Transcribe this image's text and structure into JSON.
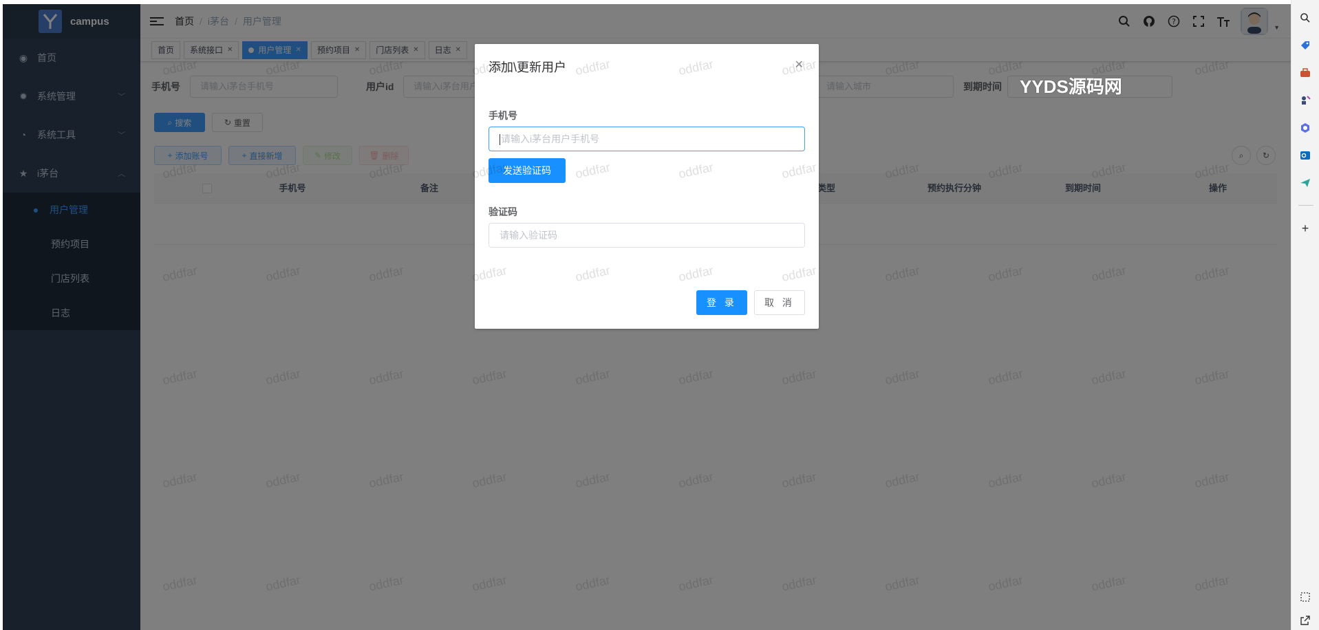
{
  "sidebar": {
    "brand": "campus",
    "items": [
      {
        "label": "首页",
        "icon": "dashboard-icon"
      },
      {
        "label": "系统管理",
        "icon": "gear-icon"
      },
      {
        "label": "系统工具",
        "icon": "tool-icon"
      },
      {
        "label": "i茅台",
        "icon": "star-icon"
      }
    ],
    "submenu": [
      {
        "label": "用户管理",
        "icon": "user-icon",
        "active": true
      },
      {
        "label": "预约项目"
      },
      {
        "label": "门店列表"
      },
      {
        "label": "日志"
      }
    ]
  },
  "navbar": {
    "breadcrumb": [
      "首页",
      "i茅台",
      "用户管理"
    ],
    "icons": [
      "search-icon",
      "github-icon",
      "help-icon",
      "fullscreen-icon",
      "font-size-icon"
    ]
  },
  "tags": [
    {
      "label": "首页",
      "active": false,
      "closable": false
    },
    {
      "label": "系统接口",
      "active": false,
      "closable": true
    },
    {
      "label": "用户管理",
      "active": true,
      "closable": true
    },
    {
      "label": "预约项目",
      "active": false,
      "closable": true
    },
    {
      "label": "门店列表",
      "active": false,
      "closable": true
    },
    {
      "label": "日志",
      "active": false,
      "closable": true
    }
  ],
  "search_form": {
    "phone_label": "手机号",
    "phone_placeholder": "请输入i茅台手机号",
    "userid_label": "用户id",
    "userid_placeholder": "请输入i茅台用户",
    "city_placeholder": "请输入城市",
    "expire_label": "到期时间",
    "search_button": "搜索",
    "reset_button": "重置"
  },
  "toolbar": {
    "add_account": "添加账号",
    "direct_add": "直接新增",
    "edit": "修改",
    "delete": "删除"
  },
  "table": {
    "columns": [
      "手机号",
      "备注",
      "类型",
      "预约执行分钟",
      "到期时间",
      "操作"
    ]
  },
  "dialog": {
    "title": "添加\\更新用户",
    "phone_label": "手机号",
    "phone_placeholder": "请输入i茅台用户手机号",
    "send_code_button": "发送验证码",
    "code_label": "验证码",
    "code_placeholder": "请输入验证码",
    "login_button": "登 录",
    "cancel_button": "取 消"
  },
  "watermark_text": "oddfar",
  "overlay_text": "YYDS源码网",
  "browser_sidebar": {
    "icons": [
      "search-icon",
      "tag-icon",
      "briefcase-icon",
      "chess-icon",
      "copilot-icon",
      "outlook-icon",
      "send-icon",
      "add-icon",
      "screenshot-icon",
      "external-icon"
    ]
  },
  "colors": {
    "sidebar_bg": "#304156",
    "primary": "#409eff",
    "dialog_button": "#1890ff"
  }
}
